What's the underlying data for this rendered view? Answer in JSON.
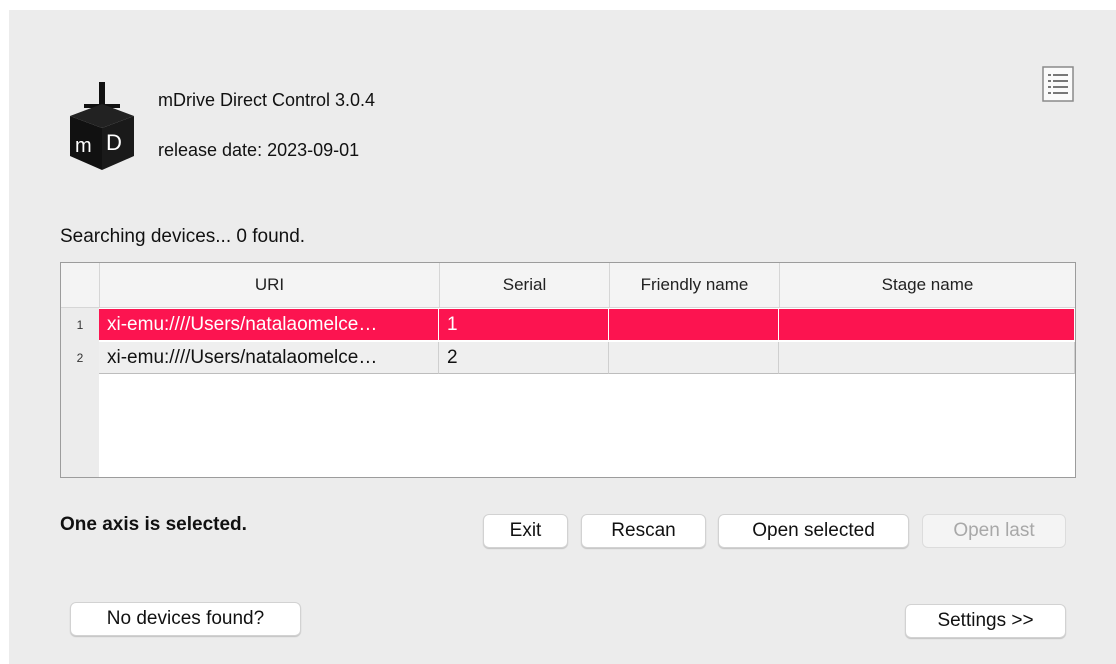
{
  "app": {
    "title": "mDrive Direct Control 3.0.4",
    "release": "release date: 2023-09-01",
    "logo_text": "mD"
  },
  "search": {
    "status": "Searching devices... 0 found."
  },
  "table": {
    "columns": [
      "URI",
      "Serial",
      "Friendly name",
      "Stage name"
    ],
    "rows": [
      {
        "index": "1",
        "uri": "xi-emu:////Users/natalaomelce…",
        "serial": "1",
        "friendly_name": "",
        "stage_name": "",
        "selected": true
      },
      {
        "index": "2",
        "uri": "xi-emu:////Users/natalaomelce…",
        "serial": "2",
        "friendly_name": "",
        "stage_name": "",
        "selected": false
      }
    ]
  },
  "footer": {
    "selection_status": "One axis is selected.",
    "exit_label": "Exit",
    "rescan_label": "Rescan",
    "open_selected_label": "Open selected",
    "open_last_label": "Open last",
    "no_devices_label": "No devices found?",
    "settings_label": "Settings >>"
  },
  "icons": {
    "logo": "mdrive-logo-icon",
    "log": "log-list-icon"
  },
  "colors": {
    "selection": "#fc1450",
    "window_bg": "#ececec"
  }
}
